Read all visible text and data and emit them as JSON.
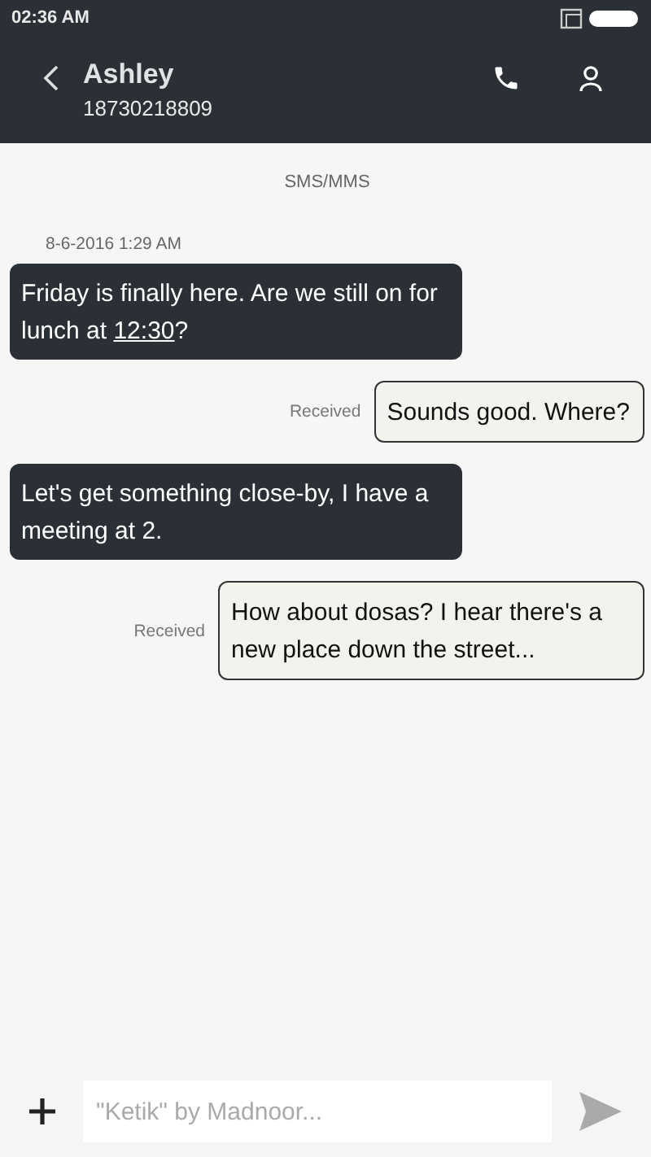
{
  "status_bar": {
    "time": "02:36 AM"
  },
  "header": {
    "name": "Ashley",
    "number": "18730218809"
  },
  "channel": "SMS/MMS",
  "timestamp": "8-6-2016 1:29 AM",
  "messages": [
    {
      "kind": "incoming",
      "parts": [
        {
          "text": "Friday is finally here. Are we still on for lunch at ",
          "link": false
        },
        {
          "text": "12:30",
          "link": true
        },
        {
          "text": "?",
          "link": false
        }
      ]
    },
    {
      "kind": "outgoing",
      "status": "Received",
      "parts": [
        {
          "text": "Sounds good. Where?",
          "link": false
        }
      ]
    },
    {
      "kind": "incoming",
      "parts": [
        {
          "text": "Let's get something close-by, I have a meeting at 2.",
          "link": false
        }
      ]
    },
    {
      "kind": "outgoing",
      "status": "Received",
      "parts": [
        {
          "text": "How about dosas? I hear there's a new place down the street...",
          "link": false
        }
      ]
    }
  ],
  "composer": {
    "placeholder": "\"Ketik\" by Madnoor..."
  }
}
